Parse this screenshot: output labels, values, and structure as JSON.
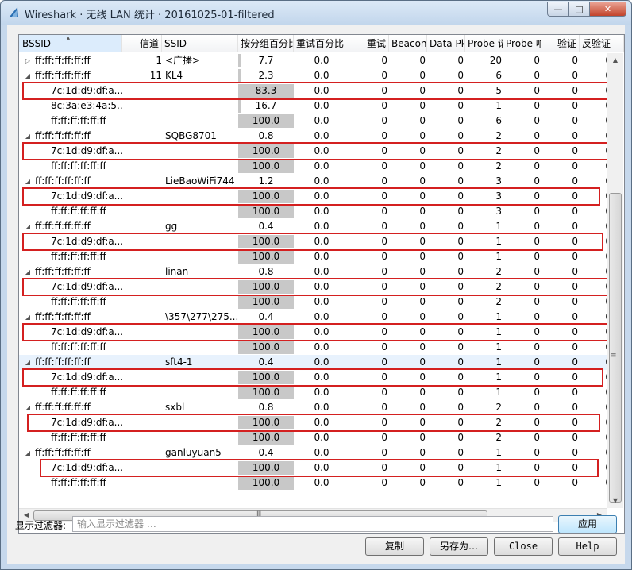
{
  "window": {
    "title": "Wireshark · 无线 LAN 统计 · 20161025-01-filtered",
    "min_glyph": "—",
    "max_glyph": "□",
    "close_glyph": "✕"
  },
  "table": {
    "sort_glyph": "▴",
    "columns": [
      "BSSID",
      "信道",
      "SSID",
      "按分组百分比",
      "重试百分比",
      "重试",
      "Beacons",
      "Data Pkts",
      "Probe 请求",
      "Probe 响应",
      "验证",
      "反验证"
    ],
    "rows": [
      {
        "arrow": "▷",
        "bssid": "ff:ff:ff:ff:ff:ff",
        "channel": "1",
        "ssid": "<广播>",
        "pct": "7.7",
        "pct_fill": 0.06,
        "retry_pct": "0.0",
        "retry": "0",
        "beacons": "0",
        "data": "0",
        "probe_req": "20",
        "probe_resp": "0",
        "auth": "0",
        "deauth": "0",
        "level": 0
      },
      {
        "arrow": "◢",
        "bssid": "ff:ff:ff:ff:ff:ff",
        "channel": "11",
        "ssid": "KL4",
        "pct": "2.3",
        "pct_fill": 0.02,
        "retry_pct": "0.0",
        "retry": "0",
        "beacons": "0",
        "data": "0",
        "probe_req": "6",
        "probe_resp": "0",
        "auth": "0",
        "deauth": "0",
        "level": 0
      },
      {
        "arrow": "",
        "bssid": "7c:1d:d9:df:a...",
        "channel": "",
        "ssid": "",
        "pct": "83.3",
        "pct_fill": 1.0,
        "retry_pct": "0.0",
        "retry": "0",
        "beacons": "0",
        "data": "0",
        "probe_req": "5",
        "probe_resp": "0",
        "auth": "0",
        "deauth": "0",
        "level": 1
      },
      {
        "arrow": "",
        "bssid": "8c:3a:e3:4a:5...",
        "channel": "",
        "ssid": "",
        "pct": "16.7",
        "pct_fill": 0.02,
        "retry_pct": "0.0",
        "retry": "0",
        "beacons": "0",
        "data": "0",
        "probe_req": "1",
        "probe_resp": "0",
        "auth": "0",
        "deauth": "0",
        "level": 1
      },
      {
        "arrow": "",
        "bssid": "ff:ff:ff:ff:ff:ff",
        "channel": "",
        "ssid": "",
        "pct": "100.0",
        "pct_fill": 1.0,
        "retry_pct": "0.0",
        "retry": "0",
        "beacons": "0",
        "data": "0",
        "probe_req": "6",
        "probe_resp": "0",
        "auth": "0",
        "deauth": "0",
        "level": 1
      },
      {
        "arrow": "◢",
        "bssid": "ff:ff:ff:ff:ff:ff",
        "channel": "",
        "ssid": "SQBG8701",
        "pct": "0.8",
        "pct_fill": 0.0,
        "retry_pct": "0.0",
        "retry": "0",
        "beacons": "0",
        "data": "0",
        "probe_req": "2",
        "probe_resp": "0",
        "auth": "0",
        "deauth": "0",
        "level": 0
      },
      {
        "arrow": "",
        "bssid": "7c:1d:d9:df:a...",
        "channel": "",
        "ssid": "",
        "pct": "100.0",
        "pct_fill": 1.0,
        "retry_pct": "0.0",
        "retry": "0",
        "beacons": "0",
        "data": "0",
        "probe_req": "2",
        "probe_resp": "0",
        "auth": "0",
        "deauth": "0",
        "level": 1
      },
      {
        "arrow": "",
        "bssid": "ff:ff:ff:ff:ff:ff",
        "channel": "",
        "ssid": "",
        "pct": "100.0",
        "pct_fill": 1.0,
        "retry_pct": "0.0",
        "retry": "0",
        "beacons": "0",
        "data": "0",
        "probe_req": "2",
        "probe_resp": "0",
        "auth": "0",
        "deauth": "0",
        "level": 1
      },
      {
        "arrow": "◢",
        "bssid": "ff:ff:ff:ff:ff:ff",
        "channel": "",
        "ssid": "LieBaoWiFi744",
        "pct": "1.2",
        "pct_fill": 0.0,
        "retry_pct": "0.0",
        "retry": "0",
        "beacons": "0",
        "data": "0",
        "probe_req": "3",
        "probe_resp": "0",
        "auth": "0",
        "deauth": "0",
        "level": 0
      },
      {
        "arrow": "",
        "bssid": "7c:1d:d9:df:a...",
        "channel": "",
        "ssid": "",
        "pct": "100.0",
        "pct_fill": 1.0,
        "retry_pct": "0.0",
        "retry": "0",
        "beacons": "0",
        "data": "0",
        "probe_req": "3",
        "probe_resp": "0",
        "auth": "0",
        "deauth": "0",
        "level": 1
      },
      {
        "arrow": "",
        "bssid": "ff:ff:ff:ff:ff:ff",
        "channel": "",
        "ssid": "",
        "pct": "100.0",
        "pct_fill": 1.0,
        "retry_pct": "0.0",
        "retry": "0",
        "beacons": "0",
        "data": "0",
        "probe_req": "3",
        "probe_resp": "0",
        "auth": "0",
        "deauth": "0",
        "level": 1
      },
      {
        "arrow": "◢",
        "bssid": "ff:ff:ff:ff:ff:ff",
        "channel": "",
        "ssid": "gg",
        "pct": "0.4",
        "pct_fill": 0.0,
        "retry_pct": "0.0",
        "retry": "0",
        "beacons": "0",
        "data": "0",
        "probe_req": "1",
        "probe_resp": "0",
        "auth": "0",
        "deauth": "0",
        "level": 0
      },
      {
        "arrow": "",
        "bssid": "7c:1d:d9:df:a...",
        "channel": "",
        "ssid": "",
        "pct": "100.0",
        "pct_fill": 1.0,
        "retry_pct": "0.0",
        "retry": "0",
        "beacons": "0",
        "data": "0",
        "probe_req": "1",
        "probe_resp": "0",
        "auth": "0",
        "deauth": "0",
        "level": 1
      },
      {
        "arrow": "",
        "bssid": "ff:ff:ff:ff:ff:ff",
        "channel": "",
        "ssid": "",
        "pct": "100.0",
        "pct_fill": 1.0,
        "retry_pct": "0.0",
        "retry": "0",
        "beacons": "0",
        "data": "0",
        "probe_req": "1",
        "probe_resp": "0",
        "auth": "0",
        "deauth": "0",
        "level": 1
      },
      {
        "arrow": "◢",
        "bssid": "ff:ff:ff:ff:ff:ff",
        "channel": "",
        "ssid": "linan",
        "pct": "0.8",
        "pct_fill": 0.0,
        "retry_pct": "0.0",
        "retry": "0",
        "beacons": "0",
        "data": "0",
        "probe_req": "2",
        "probe_resp": "0",
        "auth": "0",
        "deauth": "0",
        "level": 0
      },
      {
        "arrow": "",
        "bssid": "7c:1d:d9:df:a...",
        "channel": "",
        "ssid": "",
        "pct": "100.0",
        "pct_fill": 1.0,
        "retry_pct": "0.0",
        "retry": "0",
        "beacons": "0",
        "data": "0",
        "probe_req": "2",
        "probe_resp": "0",
        "auth": "0",
        "deauth": "0",
        "level": 1
      },
      {
        "arrow": "",
        "bssid": "ff:ff:ff:ff:ff:ff",
        "channel": "",
        "ssid": "",
        "pct": "100.0",
        "pct_fill": 1.0,
        "retry_pct": "0.0",
        "retry": "0",
        "beacons": "0",
        "data": "0",
        "probe_req": "2",
        "probe_resp": "0",
        "auth": "0",
        "deauth": "0",
        "level": 1
      },
      {
        "arrow": "◢",
        "bssid": "ff:ff:ff:ff:ff:ff",
        "channel": "",
        "ssid": "\\357\\277\\275...",
        "pct": "0.4",
        "pct_fill": 0.0,
        "retry_pct": "0.0",
        "retry": "0",
        "beacons": "0",
        "data": "0",
        "probe_req": "1",
        "probe_resp": "0",
        "auth": "0",
        "deauth": "0",
        "level": 0
      },
      {
        "arrow": "",
        "bssid": "7c:1d:d9:df:a...",
        "channel": "",
        "ssid": "",
        "pct": "100.0",
        "pct_fill": 1.0,
        "retry_pct": "0.0",
        "retry": "0",
        "beacons": "0",
        "data": "0",
        "probe_req": "1",
        "probe_resp": "0",
        "auth": "0",
        "deauth": "0",
        "level": 1
      },
      {
        "arrow": "",
        "bssid": "ff:ff:ff:ff:ff:ff",
        "channel": "",
        "ssid": "",
        "pct": "100.0",
        "pct_fill": 1.0,
        "retry_pct": "0.0",
        "retry": "0",
        "beacons": "0",
        "data": "0",
        "probe_req": "1",
        "probe_resp": "0",
        "auth": "0",
        "deauth": "0",
        "level": 1
      },
      {
        "arrow": "◢",
        "bssid": "ff:ff:ff:ff:ff:ff",
        "channel": "",
        "ssid": "sft4-1",
        "pct": "0.4",
        "pct_fill": 0.0,
        "retry_pct": "0.0",
        "retry": "0",
        "beacons": "0",
        "data": "0",
        "probe_req": "1",
        "probe_resp": "0",
        "auth": "0",
        "deauth": "0",
        "level": 0,
        "selected": true
      },
      {
        "arrow": "",
        "bssid": "7c:1d:d9:df:a...",
        "channel": "",
        "ssid": "",
        "pct": "100.0",
        "pct_fill": 1.0,
        "retry_pct": "0.0",
        "retry": "0",
        "beacons": "0",
        "data": "0",
        "probe_req": "1",
        "probe_resp": "0",
        "auth": "0",
        "deauth": "0",
        "level": 1
      },
      {
        "arrow": "",
        "bssid": "ff:ff:ff:ff:ff:ff",
        "channel": "",
        "ssid": "",
        "pct": "100.0",
        "pct_fill": 1.0,
        "retry_pct": "0.0",
        "retry": "0",
        "beacons": "0",
        "data": "0",
        "probe_req": "1",
        "probe_resp": "0",
        "auth": "0",
        "deauth": "0",
        "level": 1
      },
      {
        "arrow": "◢",
        "bssid": "ff:ff:ff:ff:ff:ff",
        "channel": "",
        "ssid": "sxbl",
        "pct": "0.8",
        "pct_fill": 0.0,
        "retry_pct": "0.0",
        "retry": "0",
        "beacons": "0",
        "data": "0",
        "probe_req": "2",
        "probe_resp": "0",
        "auth": "0",
        "deauth": "0",
        "level": 0
      },
      {
        "arrow": "",
        "bssid": "7c:1d:d9:df:a...",
        "channel": "",
        "ssid": "",
        "pct": "100.0",
        "pct_fill": 1.0,
        "retry_pct": "0.0",
        "retry": "0",
        "beacons": "0",
        "data": "0",
        "probe_req": "2",
        "probe_resp": "0",
        "auth": "0",
        "deauth": "0",
        "level": 1
      },
      {
        "arrow": "",
        "bssid": "ff:ff:ff:ff:ff:ff",
        "channel": "",
        "ssid": "",
        "pct": "100.0",
        "pct_fill": 1.0,
        "retry_pct": "0.0",
        "retry": "0",
        "beacons": "0",
        "data": "0",
        "probe_req": "2",
        "probe_resp": "0",
        "auth": "0",
        "deauth": "0",
        "level": 1
      },
      {
        "arrow": "◢",
        "bssid": "ff:ff:ff:ff:ff:ff",
        "channel": "",
        "ssid": "ganluyuan5",
        "pct": "0.4",
        "pct_fill": 0.0,
        "retry_pct": "0.0",
        "retry": "0",
        "beacons": "0",
        "data": "0",
        "probe_req": "1",
        "probe_resp": "0",
        "auth": "0",
        "deauth": "0",
        "level": 0
      },
      {
        "arrow": "",
        "bssid": "7c:1d:d9:df:a...",
        "channel": "",
        "ssid": "",
        "pct": "100.0",
        "pct_fill": 1.0,
        "retry_pct": "0.0",
        "retry": "0",
        "beacons": "0",
        "data": "0",
        "probe_req": "1",
        "probe_resp": "0",
        "auth": "0",
        "deauth": "0",
        "level": 1
      },
      {
        "arrow": "",
        "bssid": "ff:ff:ff:ff:ff:ff",
        "channel": "",
        "ssid": "",
        "pct": "100.0",
        "pct_fill": 1.0,
        "retry_pct": "0.0",
        "retry": "0",
        "beacons": "0",
        "data": "0",
        "probe_req": "1",
        "probe_resp": "0",
        "auth": "0",
        "deauth": "0",
        "level": 1
      }
    ],
    "highlighted_rows": [
      2,
      6,
      9,
      12,
      15,
      18,
      21,
      24,
      27
    ],
    "highlight_color": "#d42020"
  },
  "scrollbars": {
    "up": "▲",
    "down": "▼",
    "left": "◀",
    "right": "▶",
    "grip_v": "≡",
    "grip_h": "Ⅲ"
  },
  "filter": {
    "label": "显示过滤器:",
    "placeholder": "输入显示过滤器 …",
    "apply_label": "应用"
  },
  "buttons": {
    "copy": "复制",
    "save_as": "另存为…",
    "close": "Close",
    "help": "Help"
  }
}
